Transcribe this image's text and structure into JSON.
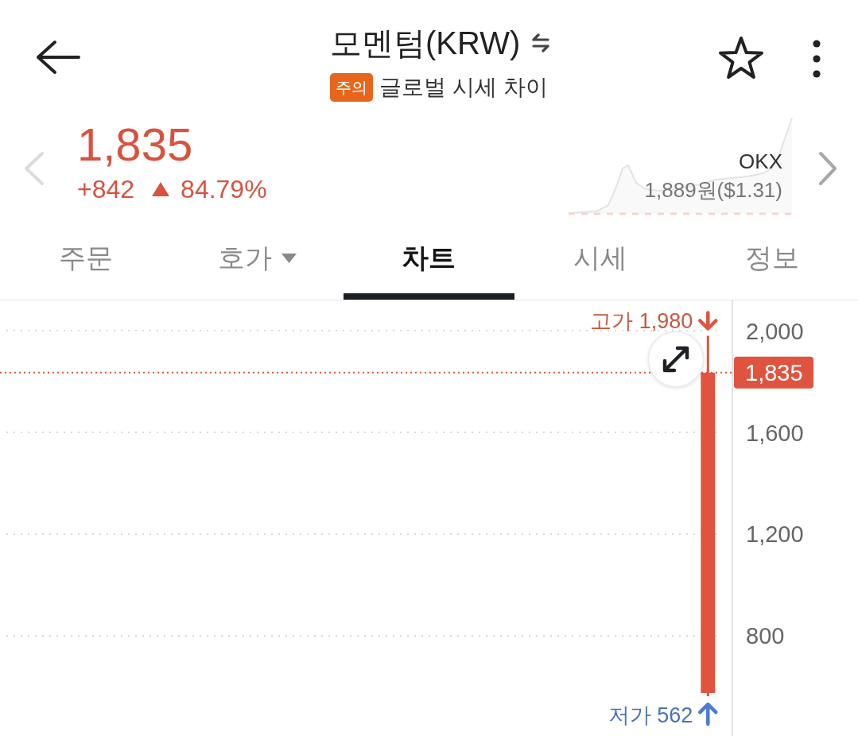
{
  "header": {
    "title": "모멘텀(KRW)",
    "badge": "주의",
    "subtitle": "글로벌 시세 차이",
    "starred": false
  },
  "ticker": {
    "price": "1,835",
    "change": "+842",
    "change_rate": "84.79%",
    "exchange": "OKX",
    "exchange_price": "1,889원($1.31)"
  },
  "tabs": [
    {
      "label": "주문",
      "selected": false,
      "dropdown": false
    },
    {
      "label": "호가",
      "selected": false,
      "dropdown": true
    },
    {
      "label": "차트",
      "selected": true,
      "dropdown": false
    },
    {
      "label": "시세",
      "selected": false,
      "dropdown": false
    },
    {
      "label": "정보",
      "selected": false,
      "dropdown": false
    }
  ],
  "chart": {
    "chart_data": {
      "type": "candlestick",
      "ylim": [
        406,
        2119
      ],
      "yticks": [
        800,
        {
          "value": 1200,
          "label": "1,200"
        },
        {
          "value": 1600,
          "label": "1,600"
        },
        {
          "value": 2000,
          "label": "2,000"
        }
      ],
      "grid": true,
      "series": [
        {
          "color": "#e0533f",
          "ohlc": [
            null,
            null,
            null,
            null,
            null,
            null,
            null,
            null,
            null,
            null,
            null,
            null,
            null,
            null,
            [
              575,
              1980,
              562,
              1835
            ]
          ]
        }
      ],
      "ref_lines": [
        {
          "axis": "y",
          "value": 1835,
          "label": "1,835"
        }
      ],
      "annotations": [
        "고가 1,980",
        "저가 562"
      ]
    }
  }
}
